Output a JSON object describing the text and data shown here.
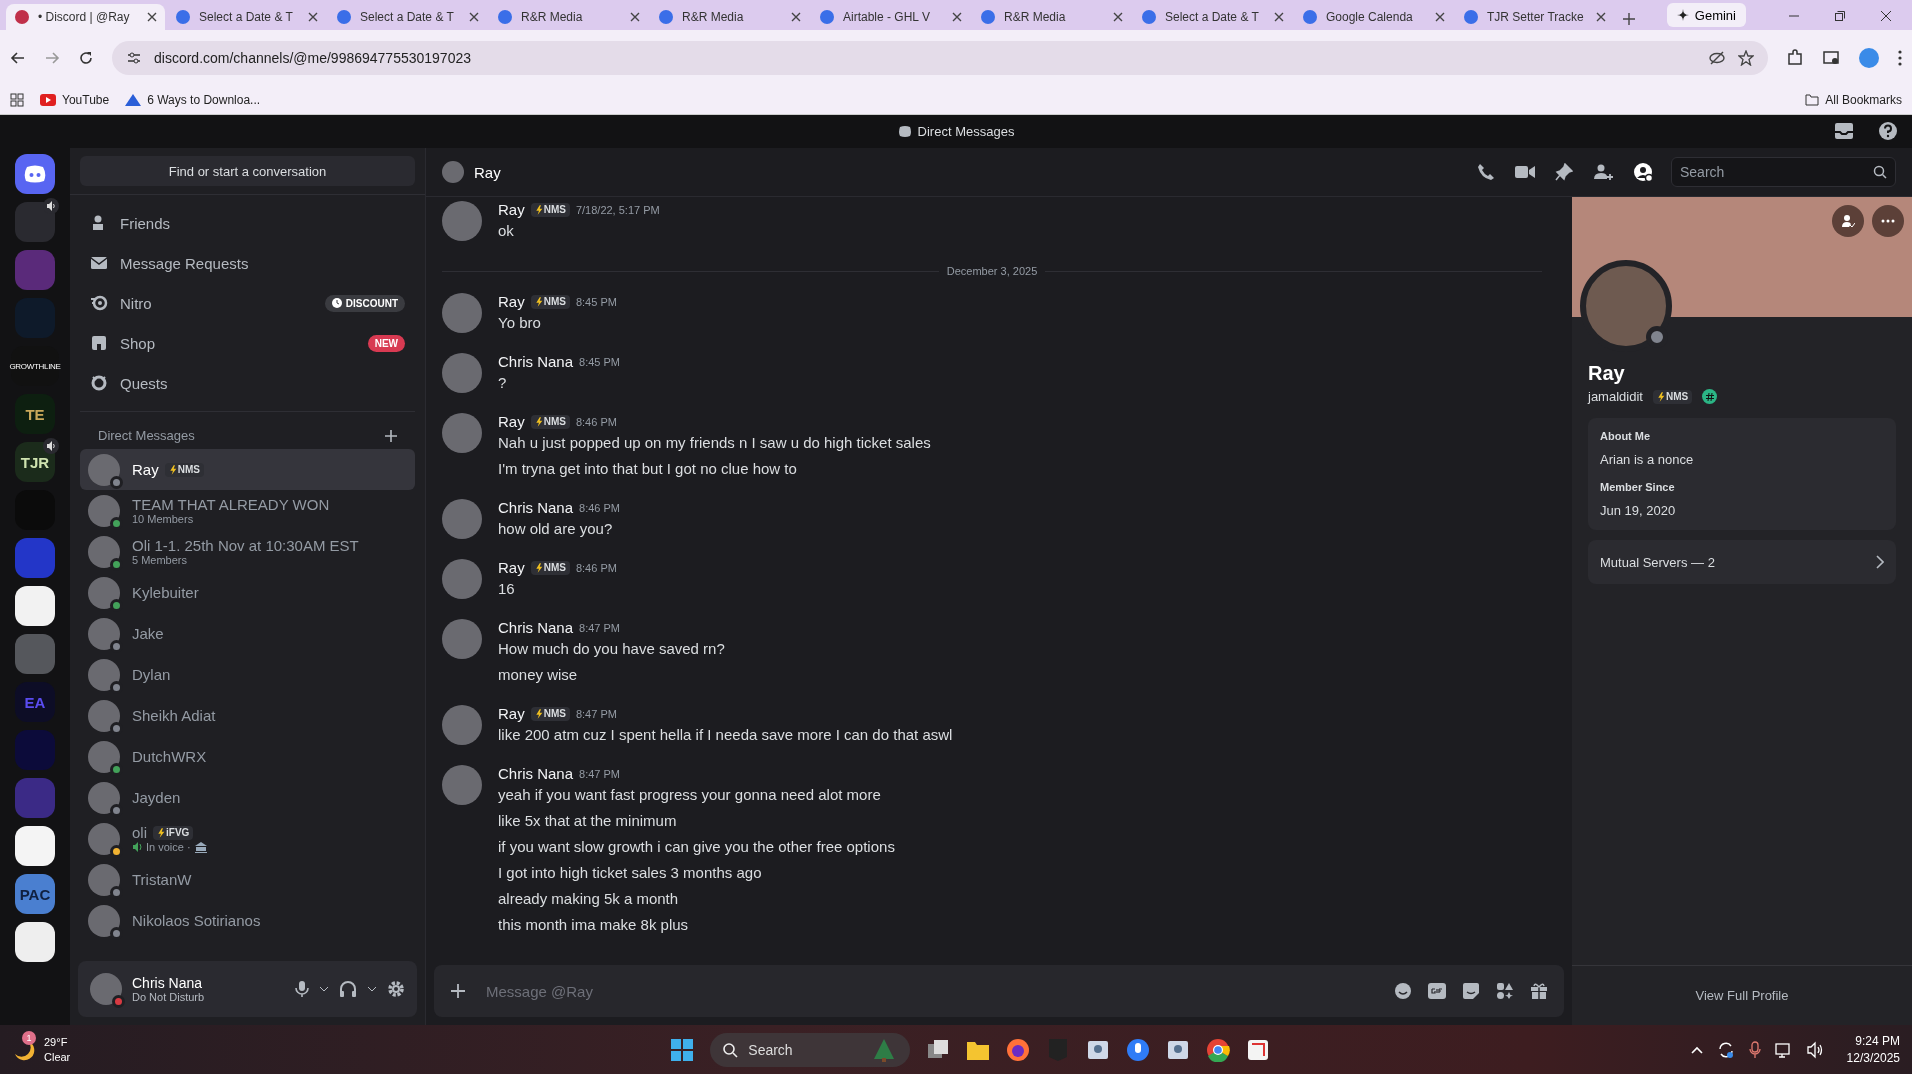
{
  "browser": {
    "tabs": [
      {
        "title": "• Discord | @Ray",
        "selected": true
      },
      {
        "title": "Select a Date & T",
        "selected": false
      },
      {
        "title": "Select a Date & T",
        "selected": false
      },
      {
        "title": "R&R Media",
        "selected": false
      },
      {
        "title": "R&R Media",
        "selected": false
      },
      {
        "title": "Airtable - GHL V",
        "selected": false
      },
      {
        "title": "R&R Media",
        "selected": false
      },
      {
        "title": "Select a Date & T",
        "selected": false
      },
      {
        "title": "Google Calenda",
        "selected": false
      },
      {
        "title": "TJR Setter Tracke",
        "selected": false
      }
    ],
    "gemini": "Gemini",
    "url": "discord.com/channels/@me/998694775530197023",
    "bookmarks": [
      "YouTube",
      "6 Ways to Downloa..."
    ],
    "all_bookmarks": "All Bookmarks"
  },
  "discord": {
    "title": "Direct Messages",
    "servers": [
      {
        "speaker": false
      },
      {
        "speaker": true
      },
      {
        "speaker": false
      },
      {
        "speaker": false
      },
      {
        "label": "GROWTHLINE",
        "speaker": false
      },
      {
        "label": "TE",
        "speaker": false
      },
      {
        "label": "TJR",
        "speaker": true
      },
      {
        "speaker": false
      },
      {
        "speaker": false
      },
      {
        "speaker": false
      },
      {
        "speaker": false
      },
      {
        "label": "EA",
        "speaker": false
      },
      {
        "speaker": false
      },
      {
        "speaker": false
      },
      {
        "speaker": false
      },
      {
        "label": "PAC",
        "speaker": false
      },
      {
        "speaker": false
      }
    ],
    "sidebar": {
      "search": "Find or start a conversation",
      "nav": [
        {
          "label": "Friends"
        },
        {
          "label": "Message Requests"
        },
        {
          "label": "Nitro",
          "badge": {
            "kind": "discount",
            "text": "DISCOUNT"
          }
        },
        {
          "label": "Shop",
          "badge": {
            "kind": "new",
            "text": "NEW"
          }
        },
        {
          "label": "Quests"
        }
      ],
      "dm_heading": "Direct Messages",
      "dms": [
        {
          "name": "Ray",
          "tag": "NMS",
          "color": "#80848e",
          "selected": true
        },
        {
          "name": "TEAM THAT ALREADY WON",
          "sub": "10 Members",
          "color": "#43a25a",
          "selected": false
        },
        {
          "name": "Oli 1-1. 25th Nov at 10:30AM EST",
          "sub": "5 Members",
          "color": "#43a25a",
          "selected": false
        },
        {
          "name": "Kylebuiter",
          "color": "#43a25a",
          "selected": false
        },
        {
          "name": "Jake",
          "color": "#80848e",
          "selected": false
        },
        {
          "name": "Dylan",
          "color": "#80848e",
          "selected": false
        },
        {
          "name": "Sheikh Adiat",
          "color": "#80848e",
          "selected": false
        },
        {
          "name": "DutchWRX",
          "color": "#43a25a",
          "selected": false
        },
        {
          "name": "Jayden",
          "color": "#80848e",
          "selected": false
        },
        {
          "name": "oli",
          "tag": "iFVG",
          "sub": "In voice ·",
          "in_voice": true,
          "color": "#f0b232",
          "selected": false
        },
        {
          "name": "TristanW",
          "color": "#80848e",
          "selected": false
        },
        {
          "name": "Nikolaos Sotirianos",
          "color": "#80848e",
          "selected": false
        }
      ],
      "user": {
        "name": "Chris Nana",
        "status_text": "Do Not Disturb",
        "color": "#d83a42"
      }
    },
    "chat": {
      "name": "Ray",
      "search_placeholder": "Search",
      "items": [
        {
          "kind": "message",
          "author": "Ray",
          "tag": "NMS",
          "time": "7/18/22, 5:17 PM",
          "lines": [
            "ok"
          ]
        },
        {
          "kind": "divider",
          "label": "December 3, 2025"
        },
        {
          "kind": "message",
          "author": "Ray",
          "tag": "NMS",
          "time": "8:45 PM",
          "lines": [
            "Yo bro"
          ]
        },
        {
          "kind": "message",
          "author": "Chris Nana",
          "time": "8:45 PM",
          "lines": [
            "?"
          ]
        },
        {
          "kind": "message",
          "author": "Ray",
          "tag": "NMS",
          "time": "8:46 PM",
          "lines": [
            "Nah u just popped up on my friends n I saw u do high ticket sales",
            "I'm tryna get into that but I got no clue how to"
          ]
        },
        {
          "kind": "message",
          "author": "Chris Nana",
          "time": "8:46 PM",
          "lines": [
            "how old are you?"
          ]
        },
        {
          "kind": "message",
          "author": "Ray",
          "tag": "NMS",
          "time": "8:46 PM",
          "lines": [
            "16"
          ]
        },
        {
          "kind": "message",
          "author": "Chris Nana",
          "time": "8:47 PM",
          "lines": [
            "How much do you have saved rn?",
            "money wise"
          ]
        },
        {
          "kind": "message",
          "author": "Ray",
          "tag": "NMS",
          "time": "8:47 PM",
          "lines": [
            "like 200 atm cuz I spent hella if I needa save more I can do that aswl"
          ]
        },
        {
          "kind": "message",
          "author": "Chris Nana",
          "time": "8:47 PM",
          "lines": [
            "yeah if you want fast progress your gonna need alot more",
            "like 5x that at the minimum",
            "if you want slow growth i can give you the other free options",
            "I got into high ticket sales 3 months ago",
            "already making 5k a month",
            "this month ima make 8k plus"
          ]
        }
      ],
      "composer_placeholder": "Message @Ray"
    },
    "profile": {
      "name": "Ray",
      "username": "jamaldidit",
      "tag": "NMS",
      "color": "#80848e",
      "about_title": "About Me",
      "about": "Arian is a nonce",
      "member_since_title": "Member Since",
      "member_since": "Jun 19, 2020",
      "mutual": "Mutual Servers — 2",
      "view_full": "View Full Profile"
    }
  },
  "taskbar": {
    "weather_badge": "1",
    "temperature": "29°F",
    "condition": "Clear",
    "search_placeholder": "Search",
    "time": "9:24 PM",
    "date": "12/3/2025"
  }
}
